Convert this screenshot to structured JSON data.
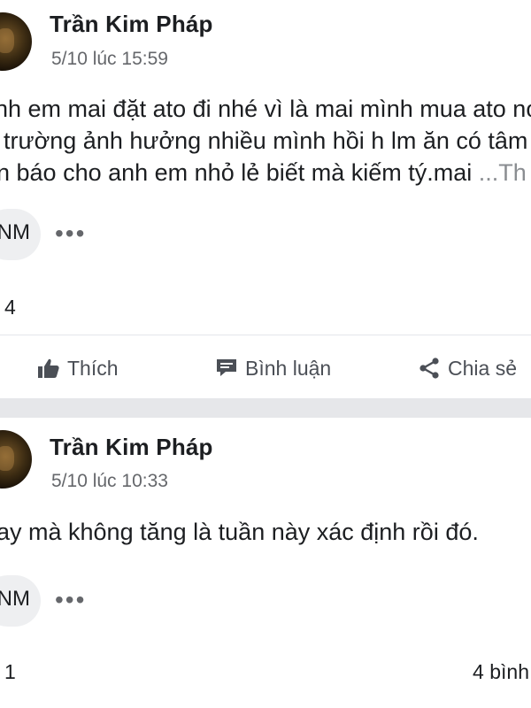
{
  "posts": [
    {
      "author": "Trần Kim Pháp",
      "time": "5/10 lúc 15:59",
      "body_lines": [
        "nh em mai đặt ato đi nhé vì là mai mình mua ato nó",
        " trường ảnh hưởng nhiều mình hồi h lm ăn có tâm",
        "n báo cho anh em nhỏ lẻ biết mà kiếm tý.mai "
      ],
      "see_more": "...Th",
      "reaction_label": "NM",
      "more_options": "•••",
      "reaction_count": "4",
      "actions": {
        "like": "Thích",
        "comment": "Bình luận",
        "share": "Chia sẻ"
      }
    },
    {
      "author": "Trần Kim Pháp",
      "time": "5/10 lúc 10:33",
      "body_lines": [
        "ay mà không tăng là tuần này xác định rồi đó."
      ],
      "reaction_label": "NM",
      "more_options": "•••",
      "reaction_count": "1",
      "comment_count": "4 bình"
    }
  ],
  "icons": {
    "like": "thumbs-up-icon",
    "comment": "comment-icon",
    "share": "share-icon"
  },
  "colors": {
    "text": "#1c1e21",
    "secondary_text": "#65676b",
    "divider": "#e6e7ea"
  }
}
